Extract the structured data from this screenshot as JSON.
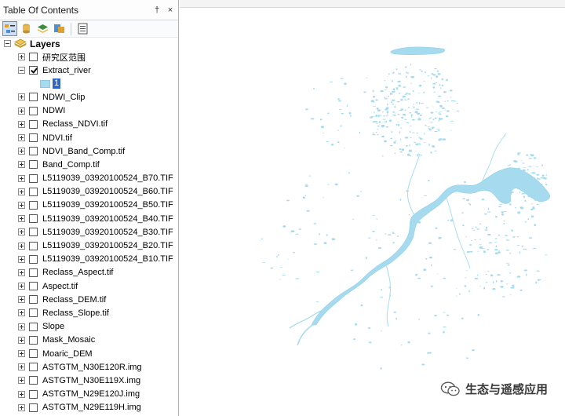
{
  "toc": {
    "title": "Table Of Contents",
    "pin_glyph": "†",
    "close_glyph": "×",
    "toolbar": [
      {
        "icon": "list-by-drawing-order-icon",
        "active": true
      },
      {
        "icon": "list-by-source-icon",
        "active": false
      },
      {
        "icon": "list-by-visibility-icon",
        "active": false
      },
      {
        "icon": "list-by-selection-icon",
        "active": false
      },
      {
        "icon": "options-icon",
        "active": false
      }
    ],
    "root_label": "Layers",
    "layers": [
      {
        "name": "研究区范围",
        "checked": false,
        "expanded": false
      },
      {
        "name": "Extract_river",
        "checked": true,
        "expanded": true,
        "legend_value": "1"
      },
      {
        "name": "NDWI_Clip",
        "checked": false,
        "expanded": false
      },
      {
        "name": "NDWI",
        "checked": false,
        "expanded": false
      },
      {
        "name": "Reclass_NDVI.tif",
        "checked": false,
        "expanded": false
      },
      {
        "name": "NDVI.tif",
        "checked": false,
        "expanded": false
      },
      {
        "name": "NDVI_Band_Comp.tif",
        "checked": false,
        "expanded": false
      },
      {
        "name": "Band_Comp.tif",
        "checked": false,
        "expanded": false
      },
      {
        "name": "L5119039_03920100524_B70.TIF",
        "checked": false,
        "expanded": false
      },
      {
        "name": "L5119039_03920100524_B60.TIF",
        "checked": false,
        "expanded": false
      },
      {
        "name": "L5119039_03920100524_B50.TIF",
        "checked": false,
        "expanded": false
      },
      {
        "name": "L5119039_03920100524_B40.TIF",
        "checked": false,
        "expanded": false
      },
      {
        "name": "L5119039_03920100524_B30.TIF",
        "checked": false,
        "expanded": false
      },
      {
        "name": "L5119039_03920100524_B20.TIF",
        "checked": false,
        "expanded": false
      },
      {
        "name": "L5119039_03920100524_B10.TIF",
        "checked": false,
        "expanded": false
      },
      {
        "name": "Reclass_Aspect.tif",
        "checked": false,
        "expanded": false
      },
      {
        "name": "Aspect.tif",
        "checked": false,
        "expanded": false
      },
      {
        "name": "Reclass_DEM.tif",
        "checked": false,
        "expanded": false
      },
      {
        "name": "Reclass_Slope.tif",
        "checked": false,
        "expanded": false
      },
      {
        "name": "Slope",
        "checked": false,
        "expanded": false
      },
      {
        "name": "Mask_Mosaic",
        "checked": false,
        "expanded": false
      },
      {
        "name": "Moaric_DEM",
        "checked": false,
        "expanded": false
      },
      {
        "name": "ASTGTM_N30E120R.img",
        "checked": false,
        "expanded": false
      },
      {
        "name": "ASTGTM_N30E119X.img",
        "checked": false,
        "expanded": false
      },
      {
        "name": "ASTGTM_N29E120J.img",
        "checked": false,
        "expanded": false
      },
      {
        "name": "ASTGTM_N29E119H.img",
        "checked": false,
        "expanded": false
      }
    ]
  },
  "map": {
    "water_color": "#a6dbef",
    "water_stroke": "#8fcfe6"
  },
  "watermark": {
    "text": "生态与遥感应用",
    "icon": "wechat-icon"
  }
}
